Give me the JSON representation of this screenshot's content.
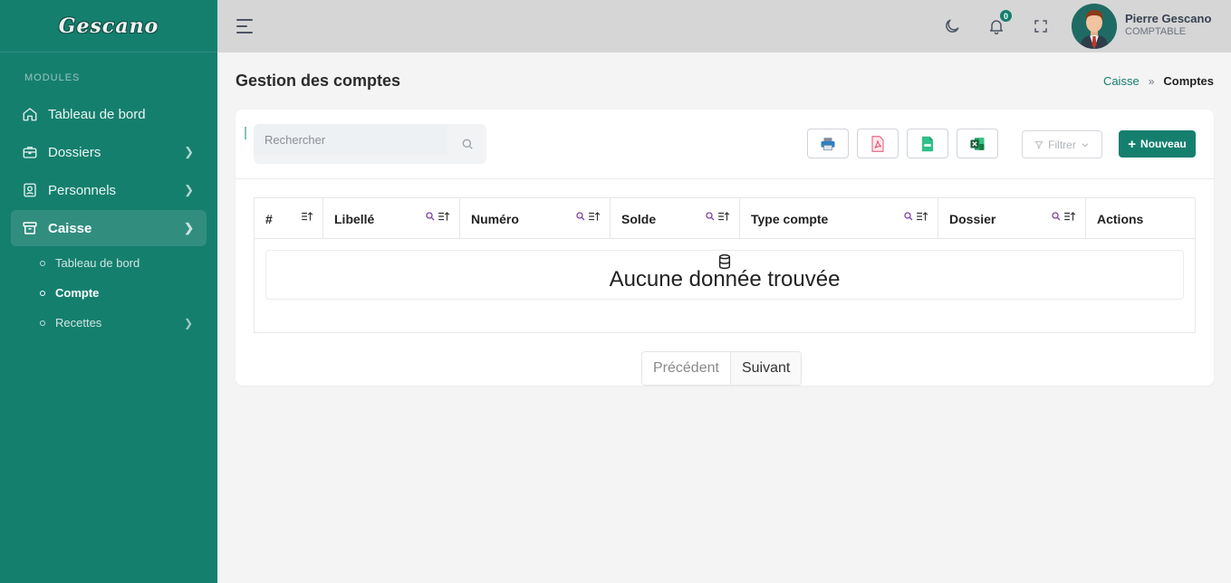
{
  "sidebar": {
    "logo_text": "Gescano",
    "modules_label": "MODULES",
    "items": [
      {
        "label": "Tableau de bord"
      },
      {
        "label": "Dossiers"
      },
      {
        "label": "Personnels"
      },
      {
        "label": "Caisse"
      }
    ],
    "sub_items": [
      {
        "label": "Tableau de bord"
      },
      {
        "label": "Compte"
      },
      {
        "label": "Recettes"
      }
    ],
    "colors": {
      "background": "#157f6e"
    }
  },
  "header": {
    "notification_count": "0",
    "user": {
      "name": "Pierre Gescano",
      "role": "COMPTABLE"
    }
  },
  "page": {
    "title": "Gestion des comptes",
    "breadcrumb": {
      "parent": "Caisse",
      "separator": "»",
      "current": "Comptes"
    }
  },
  "toolbar": {
    "search_placeholder": "Rechercher",
    "filter_label": "Filtrer",
    "new_label": "Nouveau",
    "new_icon": "+"
  },
  "table": {
    "columns": [
      "#",
      "Libellé",
      "Numéro",
      "Solde",
      "Type compte",
      "Dossier",
      "Actions"
    ],
    "empty_message": "Aucune donnée trouvée"
  },
  "pagination": {
    "previous": "Précédent",
    "next": "Suivant"
  }
}
